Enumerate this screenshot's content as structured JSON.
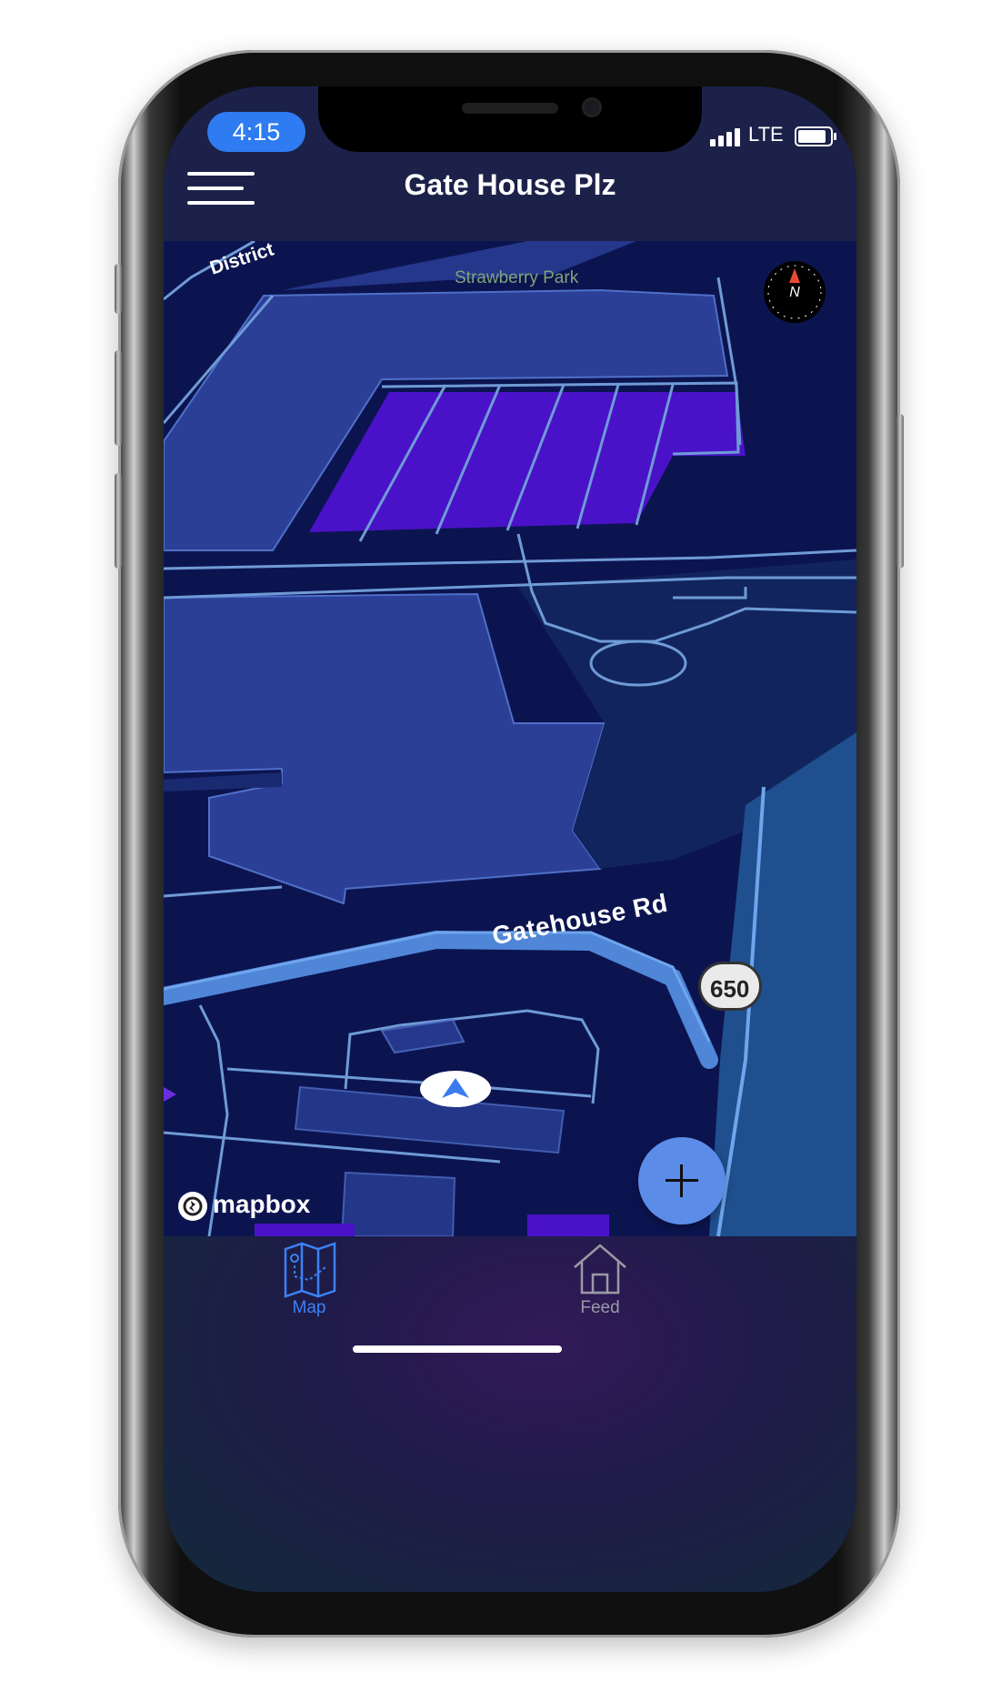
{
  "status_bar": {
    "time": "4:15",
    "network": "LTE",
    "icons": [
      "signal-bars-icon",
      "battery-icon"
    ]
  },
  "nav": {
    "title": "Gate House Plz",
    "menu_icon": "hamburger-menu-icon"
  },
  "map": {
    "labels": {
      "poi": "Strawberry Park",
      "district": "District",
      "road": "Gatehouse Rd",
      "shield": "650"
    },
    "compass": {
      "label": "N",
      "icon": "compass-icon"
    },
    "attribution": "mapbox",
    "fab_icon": "plus-icon",
    "user_location_icon": "navigation-arrow-icon"
  },
  "tabs": [
    {
      "label": "Map",
      "icon": "folded-map-icon",
      "active": true
    },
    {
      "label": "Feed",
      "icon": "house-icon",
      "active": false
    }
  ],
  "colors": {
    "accent": "#2f7bf1",
    "active_tab": "#3b82f6",
    "inactive_tab": "#9a9aa6",
    "nav_bg": "#1b2148",
    "map_bg": "#0c1450",
    "building": "#2b3f96",
    "parking": "#4a12c8",
    "fab": "#5b8de8"
  }
}
